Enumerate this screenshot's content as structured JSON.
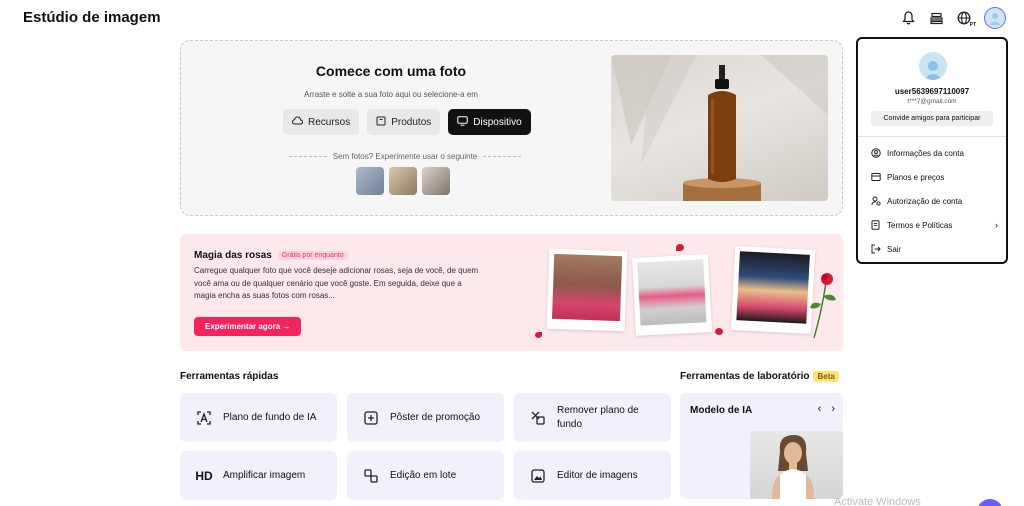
{
  "header": {
    "app_title": "Estúdio de imagem",
    "icons": [
      "bell-icon",
      "layers-icon",
      "globe-language-icon",
      "user-avatar-icon"
    ],
    "language_badge": "PT"
  },
  "upload": {
    "title": "Comece com uma foto",
    "subtitle": "Arraste e solte a sua foto aqui ou selecione-a em",
    "buttons": [
      {
        "label": "Recursos",
        "icon": "cloud-icon"
      },
      {
        "label": "Produtos",
        "icon": "box-icon"
      },
      {
        "label": "Dispositivo",
        "icon": "monitor-icon"
      }
    ],
    "try_text": "Sem fotos? Experimente usar o seguinte"
  },
  "promo": {
    "title": "Magia das rosas",
    "badge": "Grátis por enquanto",
    "description": "Carregue qualquer foto que você deseje adicionar rosas, seja de você, de quem você ama ou de qualquer cenário que você goste. Em seguida, deixe que a magia encha as suas fotos com rosas...",
    "cta": "Experimentar agora →"
  },
  "quick_tools": {
    "title": "Ferramentas rápidas",
    "items": [
      {
        "label": "Plano de fundo de IA",
        "icon": "ai-background-icon"
      },
      {
        "label": "Pôster de promoção",
        "icon": "poster-icon"
      },
      {
        "label": "Remover plano de fundo",
        "icon": "remove-background-icon"
      },
      {
        "label": "Amplificar imagem",
        "icon": "hd-icon"
      },
      {
        "label": "Edição em lote",
        "icon": "batch-edit-icon"
      },
      {
        "label": "Editor de imagens",
        "icon": "image-editor-icon"
      }
    ]
  },
  "lab_tools": {
    "title": "Ferramentas de laboratório",
    "badge": "Beta",
    "card_title": "Modelo de IA",
    "prev": "‹",
    "next": "›"
  },
  "account_menu": {
    "username": "user5639697110097",
    "email": "t***7@gmail.com",
    "invite": "Convide amigos para participar",
    "items": [
      {
        "label": "Informações da conta",
        "icon": "account-info-icon"
      },
      {
        "label": "Planos e preços",
        "icon": "plans-icon"
      },
      {
        "label": "Autorização de conta",
        "icon": "authorization-icon"
      },
      {
        "label": "Termos e Políticas",
        "icon": "terms-icon",
        "chevron": "›"
      },
      {
        "label": "Sair",
        "icon": "logout-icon"
      }
    ]
  },
  "system": {
    "watermark": "Activate Windows"
  }
}
